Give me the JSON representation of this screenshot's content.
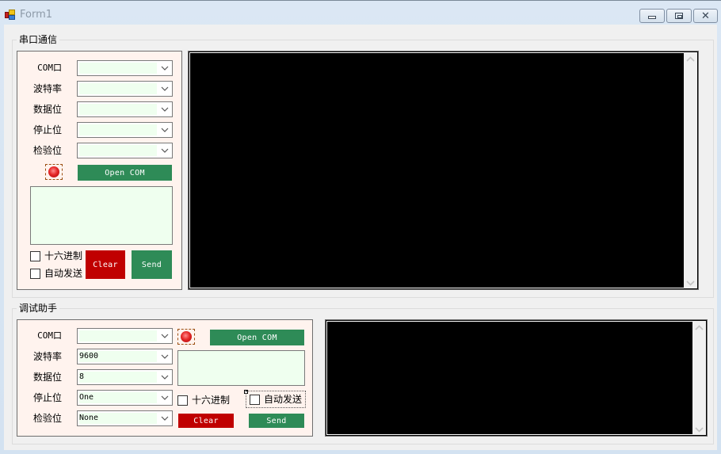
{
  "window": {
    "title": "Form1",
    "icon": "app-form-icon",
    "controls": {
      "minimize": "minimize-icon",
      "maximize": "maximize-icon",
      "close": "close-icon"
    }
  },
  "serial_group": {
    "title": "串口通信",
    "fields": [
      {
        "label": "COM口",
        "value": ""
      },
      {
        "label": "波特率",
        "value": ""
      },
      {
        "label": "数据位",
        "value": ""
      },
      {
        "label": "停止位",
        "value": ""
      },
      {
        "label": "检验位",
        "value": ""
      }
    ],
    "status_led": {
      "state": "off",
      "color": "#e52828"
    },
    "open_button": "Open COM",
    "send_text": "",
    "hex_checkbox": {
      "label": "十六进制",
      "checked": false
    },
    "auto_send_checkbox": {
      "label": "自动发送",
      "checked": false
    },
    "clear_button": "Clear",
    "send_button": "Send",
    "receive_text": ""
  },
  "debug_group": {
    "title": "调试助手",
    "fields": [
      {
        "label": "COM口",
        "value": ""
      },
      {
        "label": "波特率",
        "value": "9600"
      },
      {
        "label": "数据位",
        "value": "8"
      },
      {
        "label": "停止位",
        "value": "One"
      },
      {
        "label": "检验位",
        "value": "None"
      }
    ],
    "status_led": {
      "state": "off",
      "color": "#e52828"
    },
    "open_button": "Open COM",
    "send_text": "",
    "hex_checkbox": {
      "label": "十六进制",
      "checked": false
    },
    "auto_send_checkbox": {
      "label": "自动发送",
      "checked": false,
      "focused": true
    },
    "clear_button": "Clear",
    "send_button": "Send",
    "receive_text": ""
  },
  "colors": {
    "panel_bg": "#fff3ee",
    "input_bg": "#efffef",
    "button_green": "#2e8b57",
    "button_red": "#c00000",
    "console_bg": "#000000"
  }
}
